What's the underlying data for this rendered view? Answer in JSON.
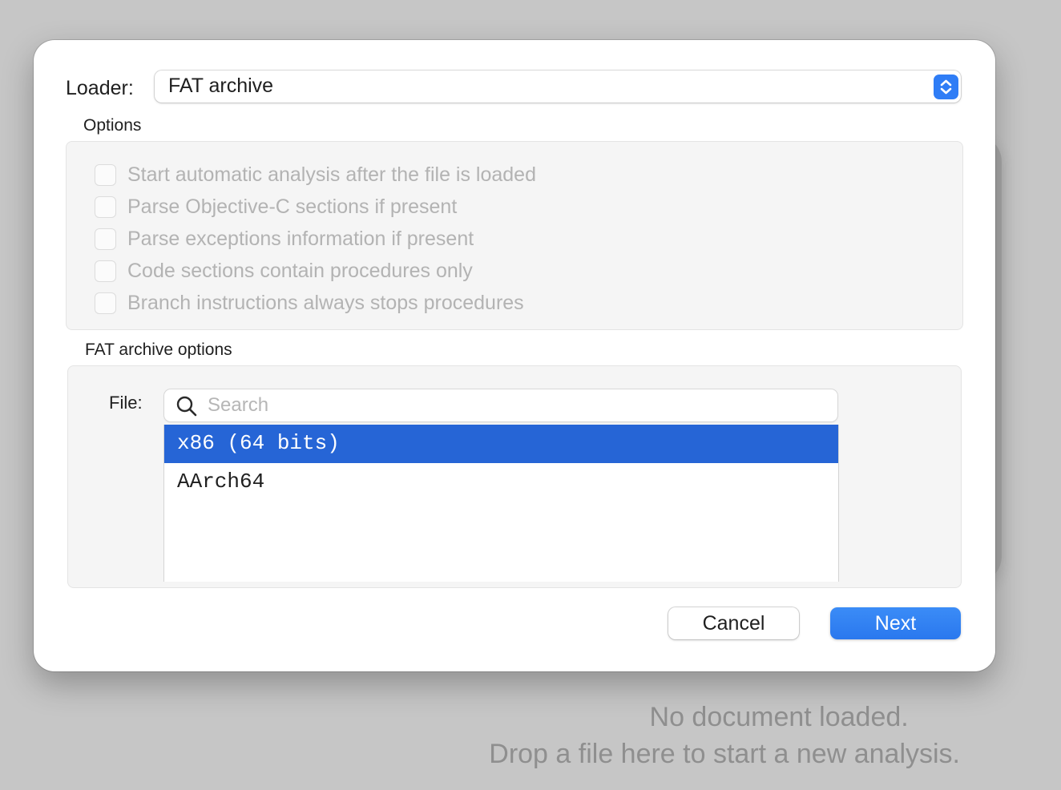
{
  "background": {
    "empty_title": "No document loaded.",
    "empty_hint": "Drop a file here to start a new analysis."
  },
  "dialog": {
    "loader_label": "Loader:",
    "loader_value": "FAT archive",
    "options_title": "Options",
    "options": [
      {
        "label": "Start automatic analysis after the file is loaded",
        "checked": false,
        "enabled": false
      },
      {
        "label": "Parse Objective-C sections if present",
        "checked": false,
        "enabled": false
      },
      {
        "label": "Parse exceptions information if present",
        "checked": false,
        "enabled": false
      },
      {
        "label": "Code sections contain procedures only",
        "checked": false,
        "enabled": false
      },
      {
        "label": "Branch instructions always stops procedures",
        "checked": false,
        "enabled": false
      }
    ],
    "fat_title": "FAT archive options",
    "file_label": "File:",
    "search": {
      "placeholder": "Search",
      "value": ""
    },
    "files": [
      {
        "label": "x86 (64 bits)",
        "selected": true
      },
      {
        "label": "AArch64",
        "selected": false
      }
    ],
    "cancel_label": "Cancel",
    "next_label": "Next"
  },
  "colors": {
    "accent": "#2f7df6",
    "selection": "#2665d6"
  },
  "icons": {
    "loader_popup": "chevron-up-down-icon",
    "search": "search-icon"
  }
}
